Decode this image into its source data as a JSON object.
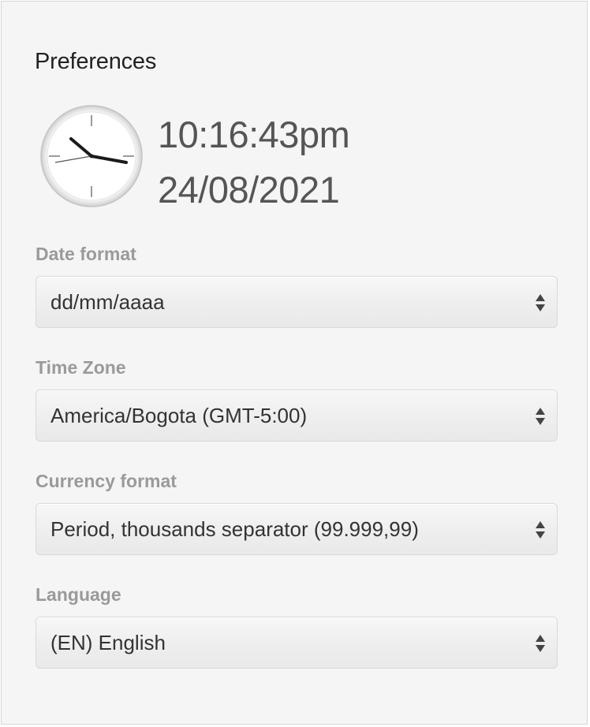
{
  "preferences": {
    "title": "Preferences",
    "clock": {
      "icon": "clock-icon",
      "time": "10:16:43pm",
      "date": "24/08/2021"
    },
    "fields": [
      {
        "label": "Date format",
        "value": "dd/mm/aaaa"
      },
      {
        "label": "Time Zone",
        "value": "America/Bogota (GMT-5:00)"
      },
      {
        "label": "Currency format",
        "value": "Period, thousands separator (99.999,99)"
      },
      {
        "label": "Language",
        "value": "(EN) English"
      }
    ]
  }
}
